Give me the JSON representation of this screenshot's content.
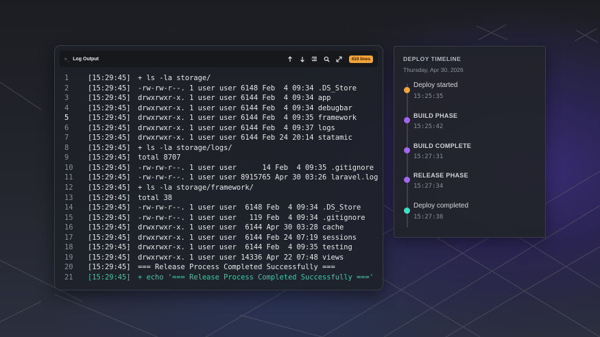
{
  "log_panel": {
    "title": "Log Output",
    "title_icon": ">_",
    "line_count_badge": "410 lines",
    "toolbar_icons": [
      "arrow-up-icon",
      "arrow-down-icon",
      "wrap-lines-icon",
      "search-icon",
      "expand-icon"
    ],
    "accent_color": "#f2a33a",
    "success_color": "#3ec9a7",
    "lines": [
      {
        "num": "1",
        "time": "[15:29:45]",
        "text": "+ ls -la storage/"
      },
      {
        "num": "2",
        "time": "[15:29:45]",
        "text": "-rw-rw-r--. 1 user user 6148 Feb  4 09:34 .DS_Store"
      },
      {
        "num": "3",
        "time": "[15:29:45]",
        "text": "drwxrwxr-x. 1 user user 6144 Feb  4 09:34 app"
      },
      {
        "num": "4",
        "time": "[15:29:45]",
        "text": "drwxrwxr-x. 1 user user 6144 Feb  4 09:34 debugbar"
      },
      {
        "num": "5",
        "time": "[15:29:45]",
        "text": "drwxrwxr-x. 1 user user 6144 Feb  4 09:35 framework"
      },
      {
        "num": "6",
        "time": "[15:29:45]",
        "text": "drwxrwxr-x. 1 user user 6144 Feb  4 09:37 logs"
      },
      {
        "num": "7",
        "time": "[15:29:45]",
        "text": "drwxrwxr-x. 1 user user 6144 Feb 24 20:14 statamic"
      },
      {
        "num": "8",
        "time": "[15:29:45]",
        "text": "+ ls -la storage/logs/"
      },
      {
        "num": "9",
        "time": "[15:29:45]",
        "text": "total 8707"
      },
      {
        "num": "10",
        "time": "[15:29:45]",
        "text": "-rw-rw-r--. 1 user user      14 Feb  4 09:35 .gitignore"
      },
      {
        "num": "11",
        "time": "[15:29:45]",
        "text": "-rw-rw-r--. 1 user user 8915765 Apr 30 03:26 laravel.log"
      },
      {
        "num": "12",
        "time": "[15:29:45]",
        "text": "+ ls -la storage/framework/"
      },
      {
        "num": "13",
        "time": "[15:29:45]",
        "text": "total 38"
      },
      {
        "num": "14",
        "time": "[15:29:45]",
        "text": "-rw-rw-r--. 1 user user  6148 Feb  4 09:34 .DS_Store"
      },
      {
        "num": "15",
        "time": "[15:29:45]",
        "text": "-rw-rw-r--. 1 user user   119 Feb  4 09:34 .gitignore"
      },
      {
        "num": "16",
        "time": "[15:29:45]",
        "text": "drwxrwxr-x. 1 user user  6144 Apr 30 03:28 cache"
      },
      {
        "num": "17",
        "time": "[15:29:45]",
        "text": "drwxrwxr-x. 1 user user  6144 Feb 24 07:19 sessions"
      },
      {
        "num": "18",
        "time": "[15:29:45]",
        "text": "drwxrwxr-x. 1 user user  6144 Feb  4 09:35 testing"
      },
      {
        "num": "19",
        "time": "[15:29:45]",
        "text": "drwxrwxr-x. 1 user user 14336 Apr 22 07:48 views"
      },
      {
        "num": "20",
        "time": "[15:29:45]",
        "text": "=== Release Process Completed Successfully ==="
      },
      {
        "num": "21",
        "time": "[15:29:45]",
        "text": "+ echo '=== Release Process Completed Successfully ==='",
        "status": "success"
      }
    ]
  },
  "timeline": {
    "title": "DEPLOY TIMELINE",
    "date": "Thursday, Apr 30, 2026",
    "events": [
      {
        "label": "Deploy started",
        "time": "15:25:35",
        "color": "#f2a33a",
        "style": "event"
      },
      {
        "label": "BUILD PHASE",
        "time": "15:25:42",
        "color": "#a466ee",
        "style": "phase"
      },
      {
        "label": "BUILD COMPLETE",
        "time": "15:27:31",
        "color": "#a466ee",
        "style": "phase"
      },
      {
        "label": "RELEASE PHASE",
        "time": "15:27:34",
        "color": "#a466ee",
        "style": "phase"
      },
      {
        "label": "Deploy completed",
        "time": "15:27:38",
        "color": "#3fe0c8",
        "style": "event"
      }
    ]
  }
}
